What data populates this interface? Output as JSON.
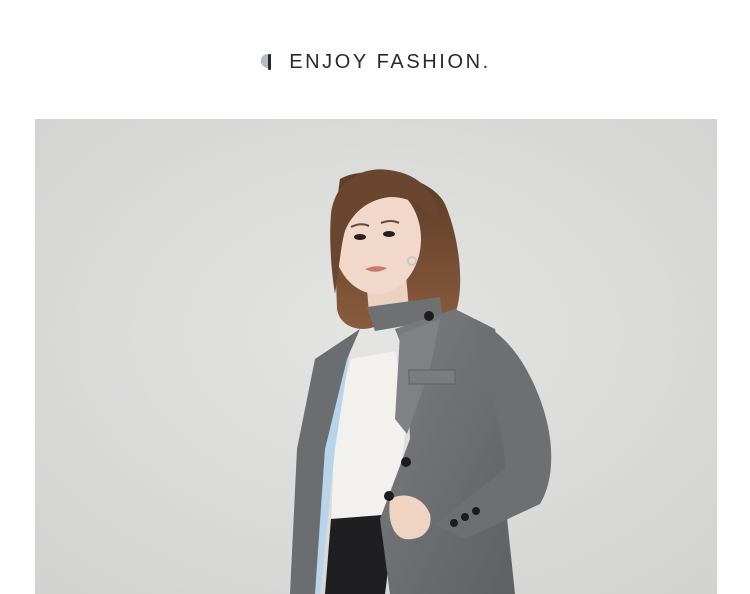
{
  "header": {
    "tagline": "ENJOY FASHION.",
    "mark_icon": "leaf-mark-icon"
  },
  "hero": {
    "subject": "model-in-grey-blazer",
    "colors": {
      "backdrop": "#dcdcdb",
      "blazer": "#6f7072",
      "top": "#f2f1ee",
      "lining": "#b9d3ea",
      "trousers": "#1f1f22",
      "hair": "#6a4630",
      "skin": "#f0d6c8"
    }
  }
}
